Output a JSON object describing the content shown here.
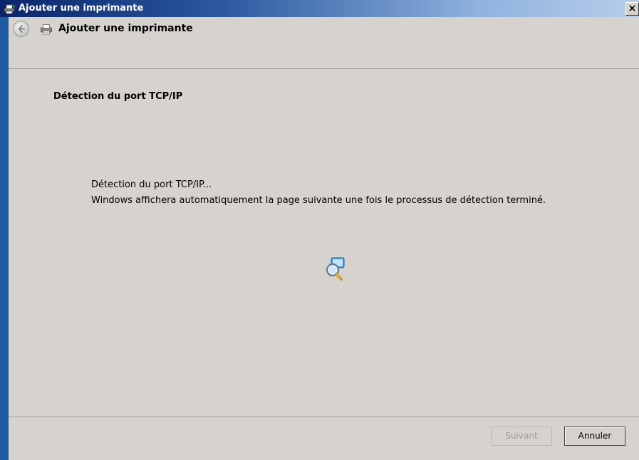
{
  "window": {
    "title": "Ajouter une imprimante",
    "close_glyph": "×"
  },
  "header": {
    "title": "Ajouter une imprimante",
    "back_icon": "back-arrow-icon",
    "printer_icon": "printer-icon"
  },
  "main": {
    "section_title": "Détection du port TCP/IP",
    "status_line": "Détection du port TCP/IP...",
    "info_line": "Windows affichera automatiquement la page suivante une fois le processus de détection terminé.",
    "progress_icon": "network-search-icon"
  },
  "footer": {
    "next_label": "Suivant",
    "next_enabled": false,
    "cancel_label": "Annuler"
  },
  "colors": {
    "titlebar_start": "#0a246a",
    "titlebar_end": "#b7cdea",
    "dialog_bg": "#d6d3ce",
    "disabled_text": "#a09d98"
  }
}
